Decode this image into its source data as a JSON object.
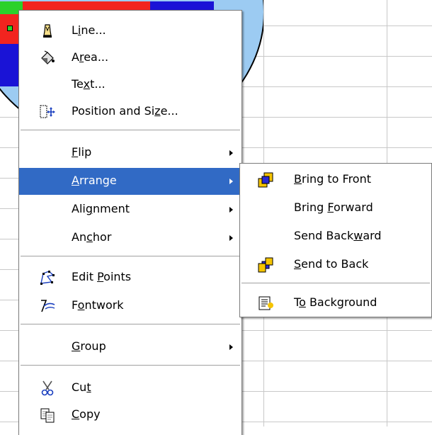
{
  "context_menu": {
    "items": [
      {
        "pre": "L",
        "ul": "i",
        "post": "ne...",
        "icon": "line-icon"
      },
      {
        "pre": "A",
        "ul": "r",
        "post": "ea...",
        "icon": "area-fill-icon"
      },
      {
        "pre": "Te",
        "ul": "x",
        "post": "t..."
      },
      {
        "pre": "Position and Si",
        "ul": "z",
        "post": "e...",
        "icon": "position-size-icon"
      },
      {
        "pre": "",
        "ul": "F",
        "post": "lip",
        "submenu": true
      },
      {
        "pre": "",
        "ul": "A",
        "post": "rrange",
        "submenu": true,
        "active": true
      },
      {
        "pre": "Ali",
        "ul": "g",
        "post": "nment",
        "submenu": true
      },
      {
        "pre": "An",
        "ul": "c",
        "post": "hor",
        "submenu": true
      },
      {
        "pre": "Edit ",
        "ul": "P",
        "post": "oints",
        "icon": "edit-points-icon"
      },
      {
        "pre": "F",
        "ul": "o",
        "post": "ntwork",
        "icon": "fontwork-icon"
      },
      {
        "pre": "",
        "ul": "G",
        "post": "roup",
        "submenu": true
      },
      {
        "pre": "Cu",
        "ul": "t",
        "post": "",
        "icon": "scissors-icon"
      },
      {
        "pre": "",
        "ul": "C",
        "post": "opy",
        "icon": "copy-icon"
      }
    ]
  },
  "arrange_submenu": {
    "items": [
      {
        "pre": "",
        "ul": "B",
        "post": "ring to Front",
        "icon": "bring-to-front-icon"
      },
      {
        "pre": "Bring ",
        "ul": "F",
        "post": "orward"
      },
      {
        "pre": "Send Back",
        "ul": "w",
        "post": "ard"
      },
      {
        "pre": "",
        "ul": "S",
        "post": "end to Back",
        "icon": "send-to-back-icon"
      },
      {
        "pre": "T",
        "ul": "o",
        "post": " Background",
        "icon": "to-background-icon"
      }
    ]
  },
  "colors": {
    "highlight": "#316ac5",
    "circle_fill": "#9ccbf2",
    "segment_green": "#2bd12b",
    "segment_red": "#f2241f",
    "segment_blue": "#1a13d6"
  }
}
